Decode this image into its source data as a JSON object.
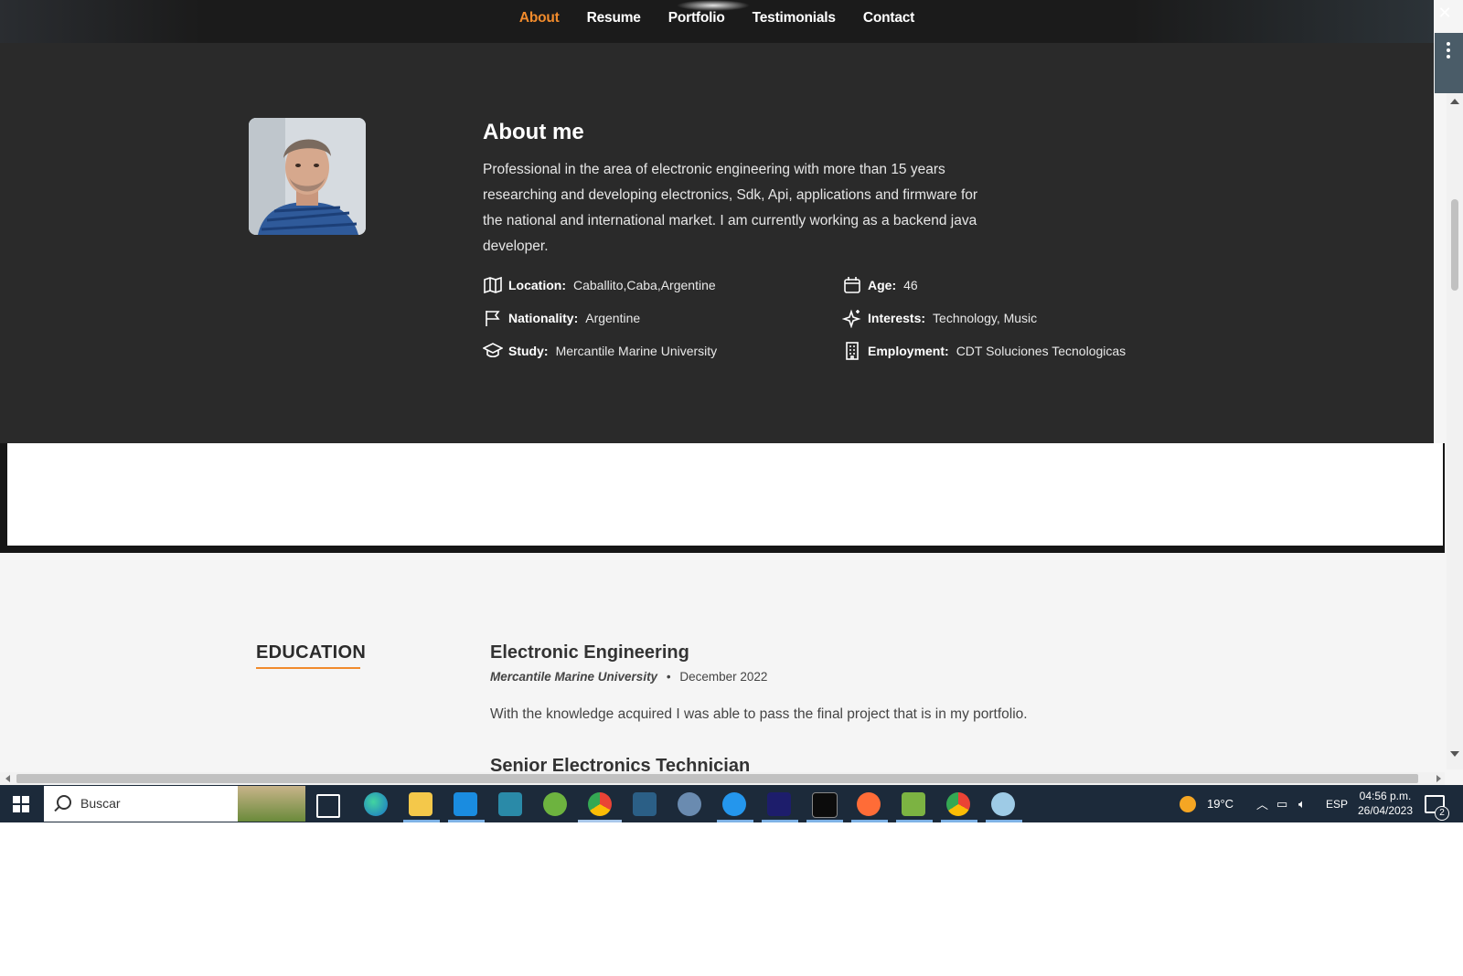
{
  "nav": {
    "items": [
      {
        "label": "About",
        "active": true
      },
      {
        "label": "Resume",
        "active": false
      },
      {
        "label": "Portfolio",
        "active": false
      },
      {
        "label": "Testimonials",
        "active": false
      },
      {
        "label": "Contact",
        "active": false
      }
    ],
    "accent_color": "#f18b2c"
  },
  "about": {
    "title": "About me",
    "description": "Professional in the area of electronic engineering with more than 15 years researching and developing electronics, Sdk, Api, applications and firmware for the national and international market. I am currently working as a backend java developer.",
    "facts": [
      {
        "icon": "map-icon",
        "label": "Location:",
        "value": "Caballito,Caba,Argentine"
      },
      {
        "icon": "calendar-icon",
        "label": "Age:",
        "value": "46"
      },
      {
        "icon": "flag-icon",
        "label": "Nationality:",
        "value": "Argentine"
      },
      {
        "icon": "sparkles-icon",
        "label": "Interests:",
        "value": "Technology, Music"
      },
      {
        "icon": "graduation-cap-icon",
        "label": "Study:",
        "value": "Mercantile Marine University"
      },
      {
        "icon": "building-icon",
        "label": "Employment:",
        "value": "CDT Soluciones Tecnologicas"
      }
    ]
  },
  "resume": {
    "section_title": "EDUCATION",
    "items": [
      {
        "title": "Electronic Engineering",
        "institution": "Mercantile Marine University",
        "separator": "•",
        "date": "December 2022",
        "description": "With the knowledge acquired I was able to pass the final project that is in my portfolio."
      },
      {
        "title": "Senior Electronics Technician"
      }
    ]
  },
  "taskbar": {
    "search_placeholder": "Buscar",
    "weather": "19°C",
    "language": "ESP",
    "time": "04:56 p.m.",
    "date": "26/04/2023",
    "notification_count": "2",
    "apps": [
      "edge-icon",
      "file-explorer-icon",
      "vscode-icon",
      "app-icon",
      "spring-icon",
      "chrome-icon",
      "mysql-workbench-icon",
      "postgres-icon",
      "docker-icon",
      "intellij-icon",
      "terminal-icon",
      "postman-icon",
      "chart-app-icon",
      "chrome-profile-icon",
      "paint-icon"
    ]
  }
}
